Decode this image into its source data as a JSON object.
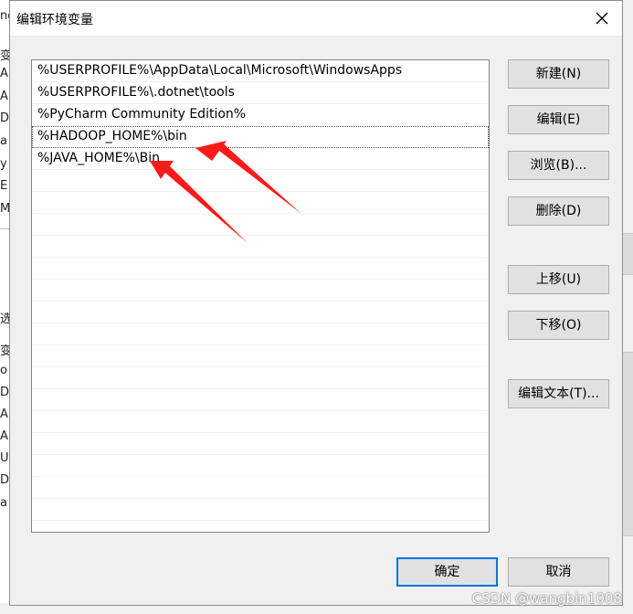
{
  "dialog": {
    "title": "编辑环境变量",
    "close_icon": "close-icon"
  },
  "paths": [
    "%USERPROFILE%\\AppData\\Local\\Microsoft\\WindowsApps",
    "%USERPROFILE%\\.dotnet\\tools",
    "%PyCharm Community Edition%",
    "%HADOOP_HOME%\\bin",
    "%JAVA_HOME%\\Bin"
  ],
  "selected_index": 3,
  "buttons": {
    "new": "新建(N)",
    "edit": "编辑(E)",
    "browse": "浏览(B)...",
    "delete": "删除(D)",
    "move_up": "上移(U)",
    "move_down": "下移(O)",
    "edit_text": "编辑文本(T)...",
    "ok": "确定",
    "cancel": "取消"
  },
  "background_glyphs": [
    "ng",
    "变",
    "A",
    "A",
    "Dr",
    "a",
    "y",
    "E",
    "M",
    "选",
    "变",
    "o",
    "Dr",
    "A",
    "A",
    "U",
    "DS",
    "a"
  ],
  "annotation": {
    "arrow_color": "#ff1a1a"
  },
  "watermark": "CSDN @wangbin1008"
}
